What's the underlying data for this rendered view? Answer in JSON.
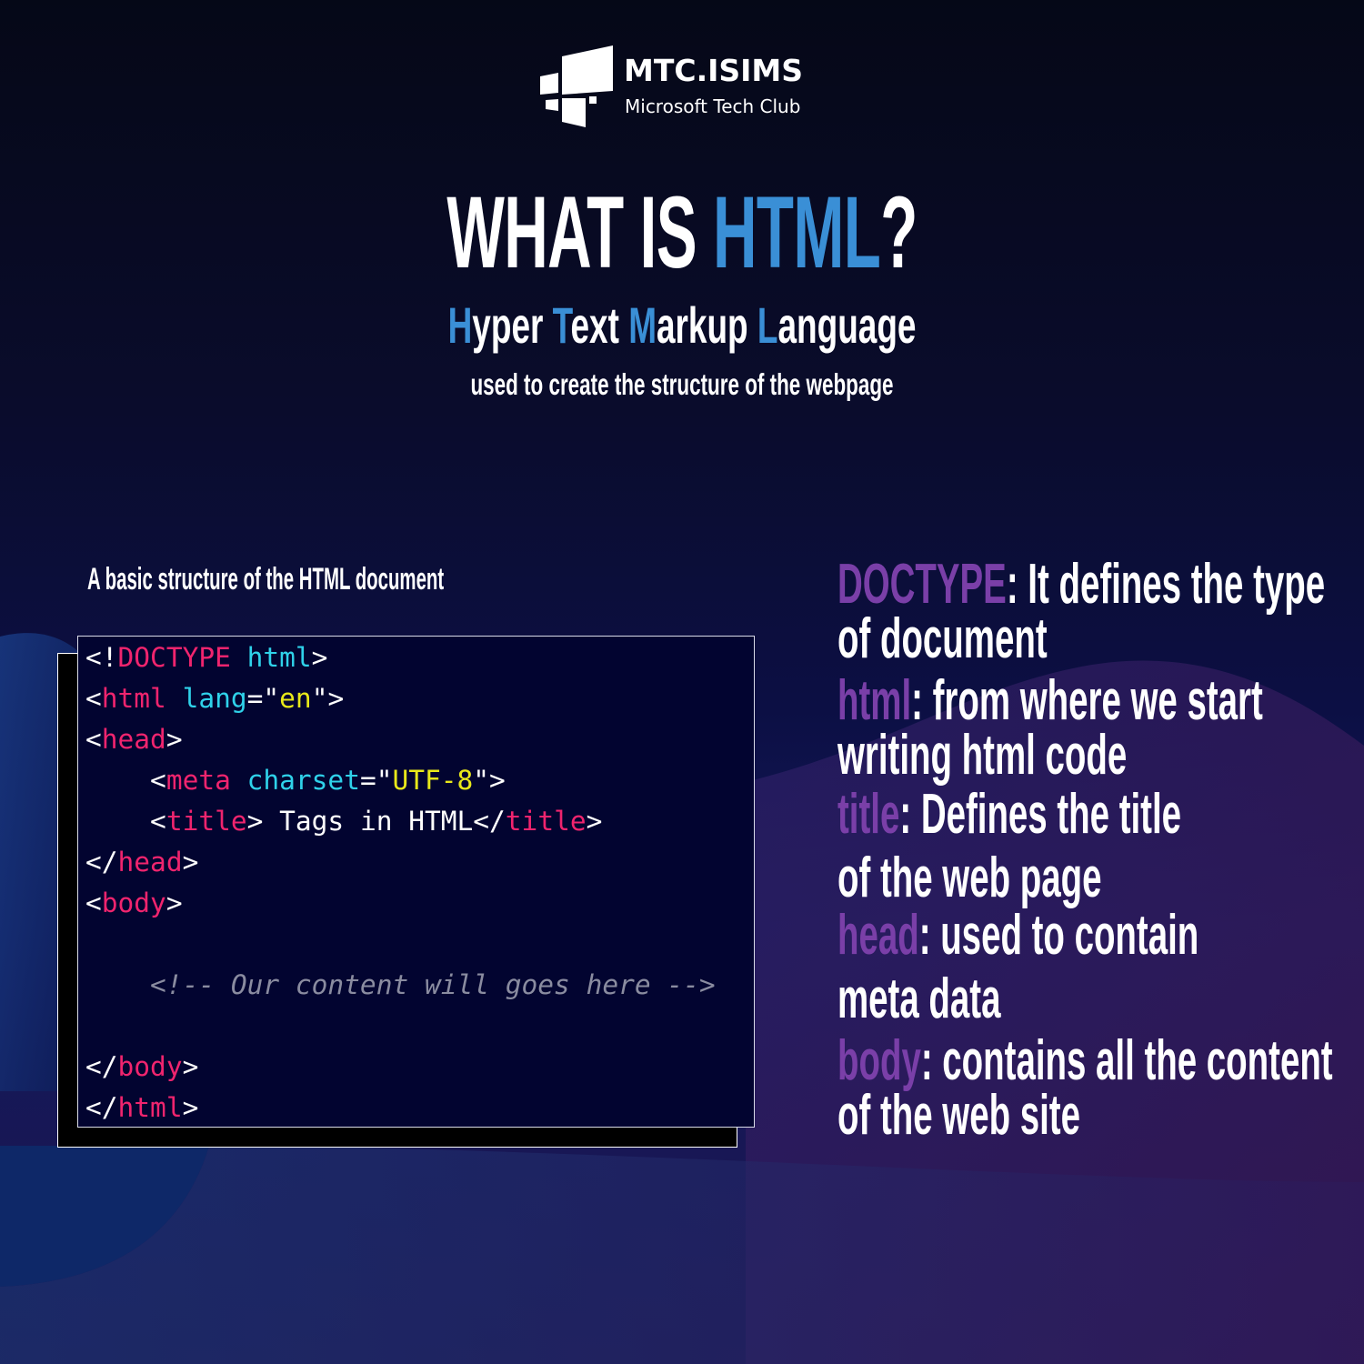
{
  "logo": {
    "title": "MTC.ISIMS",
    "subtitle": "Microsoft Tech Club",
    "icon": "stacked-windows-icon"
  },
  "headline": {
    "prefix": "WHAT IS ",
    "highlight": "HTML",
    "suffix": "?"
  },
  "expansion": [
    {
      "first": "H",
      "rest": "yper"
    },
    {
      "first": "T",
      "rest": "ext"
    },
    {
      "first": "M",
      "rest": "arkup"
    },
    {
      "first": "L",
      "rest": "anguage"
    }
  ],
  "tagline": "used to create the structure of the webpage",
  "code_section": {
    "caption": "A basic structure of the HTML document",
    "lines": [
      [
        {
          "t": "<!",
          "c": "white"
        },
        {
          "t": "DOCTYPE",
          "c": "pink"
        },
        {
          "t": " ",
          "c": "white"
        },
        {
          "t": "html",
          "c": "cyan"
        },
        {
          "t": ">",
          "c": "white"
        }
      ],
      [
        {
          "t": "<",
          "c": "white"
        },
        {
          "t": "html",
          "c": "pink"
        },
        {
          "t": " ",
          "c": "white"
        },
        {
          "t": "lang",
          "c": "cyan"
        },
        {
          "t": "=\"",
          "c": "white"
        },
        {
          "t": "en",
          "c": "yellow"
        },
        {
          "t": "\">",
          "c": "white"
        }
      ],
      [
        {
          "t": "<",
          "c": "white"
        },
        {
          "t": "head",
          "c": "pink"
        },
        {
          "t": ">",
          "c": "white"
        }
      ],
      [
        {
          "t": "    <",
          "c": "white"
        },
        {
          "t": "meta",
          "c": "pink"
        },
        {
          "t": " ",
          "c": "white"
        },
        {
          "t": "charset",
          "c": "cyan"
        },
        {
          "t": "=\"",
          "c": "white"
        },
        {
          "t": "UTF-8",
          "c": "yellow"
        },
        {
          "t": "\">",
          "c": "white"
        }
      ],
      [
        {
          "t": "    <",
          "c": "white"
        },
        {
          "t": "title",
          "c": "pink"
        },
        {
          "t": "> Tags in HTML</",
          "c": "white"
        },
        {
          "t": "title",
          "c": "pink"
        },
        {
          "t": ">",
          "c": "white"
        }
      ],
      [
        {
          "t": "</",
          "c": "white"
        },
        {
          "t": "head",
          "c": "pink"
        },
        {
          "t": ">",
          "c": "white"
        }
      ],
      [
        {
          "t": "<",
          "c": "white"
        },
        {
          "t": "body",
          "c": "pink"
        },
        {
          "t": ">",
          "c": "white"
        }
      ],
      [],
      [
        {
          "t": "    <!-- Our content will goes here -->",
          "c": "comment"
        }
      ],
      [],
      [
        {
          "t": "</",
          "c": "white"
        },
        {
          "t": "body",
          "c": "pink"
        },
        {
          "t": ">",
          "c": "white"
        }
      ],
      [
        {
          "t": "</",
          "c": "white"
        },
        {
          "t": "html",
          "c": "pink"
        },
        {
          "t": ">",
          "c": "white"
        }
      ]
    ]
  },
  "definitions": [
    {
      "keyword": "DOCTYPE",
      "text": ":  It defines the type"
    },
    {
      "keyword": "",
      "text": "of document"
    },
    {
      "keyword": "html",
      "text": ":  from where we start"
    },
    {
      "keyword": "",
      "text": "writing html code"
    },
    {
      "keyword": "title",
      "text": ": Defines the title"
    },
    {
      "keyword": "",
      "text": "of the web page"
    },
    {
      "keyword": "head",
      "text": ":  used to contain"
    },
    {
      "keyword": "",
      "text": "meta data"
    },
    {
      "keyword": "body",
      "text": ": contains all the content"
    },
    {
      "keyword": "",
      "text": "of the web site"
    }
  ],
  "colors": {
    "accent_blue": "#3a8fd6",
    "keyword_purple": "#7a3fa8",
    "code_pink": "#f0246e",
    "code_cyan": "#2fd2ea",
    "code_yellow": "#e8e81a",
    "code_comment": "#8a8ca0"
  }
}
